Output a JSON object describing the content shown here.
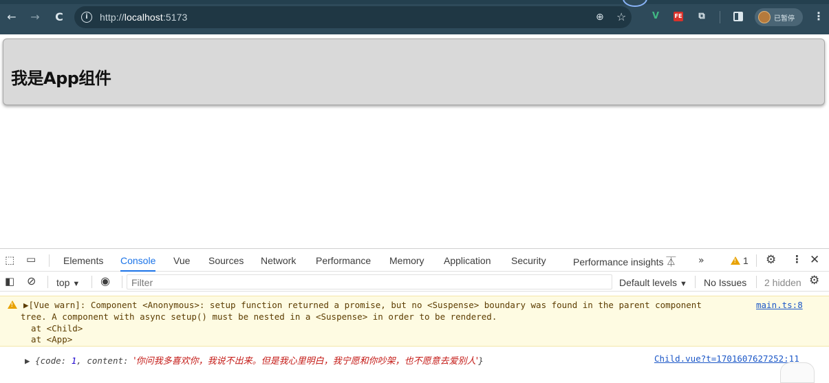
{
  "browser": {
    "url_prefix": "http://",
    "url_host": "localhost",
    "url_port": ":5173",
    "back_icon": "←",
    "forward_icon": "→",
    "reload_icon": "C",
    "zoom_icon": "⊕",
    "star_icon": "☆",
    "ext_vue": "V",
    "ext_fe": "FE",
    "puzzle_icon": "⧉",
    "profile_label": "已暂停",
    "menu_icon": "⋮"
  },
  "page": {
    "heading": "我是App组件"
  },
  "devtools": {
    "tabs": [
      "Elements",
      "Console",
      "Vue",
      "Sources",
      "Network",
      "Performance",
      "Memory",
      "Application",
      "Security",
      "Performance insights"
    ],
    "active_tab": "Console",
    "more_tabs": "»",
    "warning_count": "1",
    "toolbar": {
      "context": "top",
      "context_arrow": "▼",
      "filter_placeholder": "Filter",
      "levels": "Default levels",
      "levels_arrow": "▼",
      "issues": "No Issues",
      "hidden": "2 hidden"
    },
    "warning_message": {
      "line1": "▶[Vue warn]: Component <Anonymous>: setup function returned a promise, but no <Suspense> boundary was found in the parent component",
      "line2": "tree. A component with async setup() must be nested in a <Suspense> in order to be rendered.",
      "line3": "  at <Child>",
      "line4": "  at <App>",
      "source": "main.ts:8"
    },
    "log_message": {
      "prefix": "▶ {",
      "code_key": "code: ",
      "code_value": "1",
      "content_key": ", content: ",
      "content_value": "'你问我多喜欢你，我说不出来。但是我心里明白，我宁愿和你吵架，也不愿意去爱别人'",
      "suffix": "}",
      "source": "Child.vue?t=1701607627252:11"
    }
  },
  "colors": {
    "browser_bar": "#2e4a5a",
    "active_tab": "#1a73e8",
    "warning_bg": "#fefbe2",
    "warning_icon": "#e8a200"
  }
}
